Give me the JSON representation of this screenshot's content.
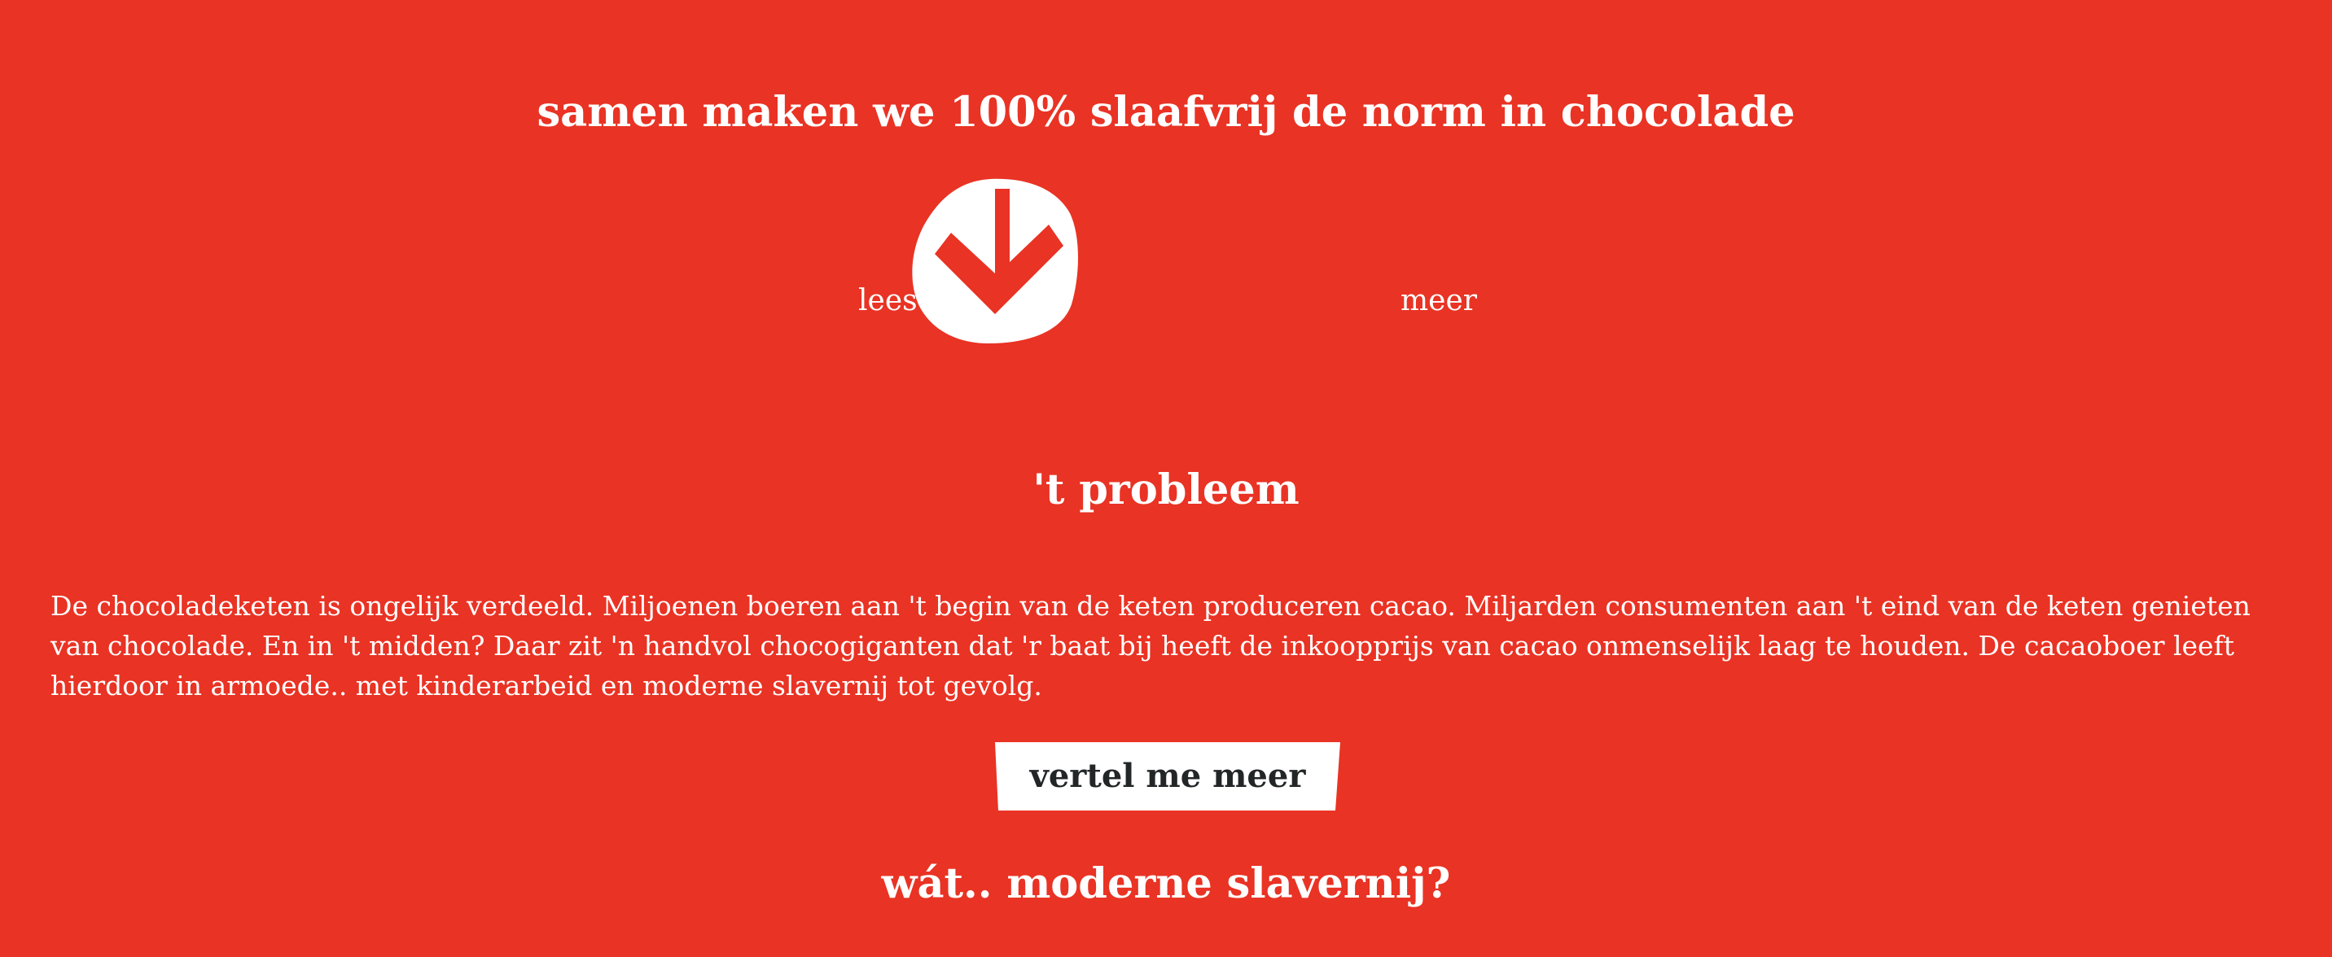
{
  "hero": {
    "title": "samen maken we 100% slaafvrij de norm in chocolade"
  },
  "read_more": {
    "left_word": "lees",
    "right_word": "meer",
    "icon": "down-arrow-blob-icon"
  },
  "problem": {
    "title": "'t probleem",
    "body": "De chocoladeketen is ongelijk verdeeld. Miljoenen boeren aan 't begin van de keten produceren cacao. Miljarden consumenten aan 't eind van de keten genieten van chocolade. En in 't midden? Daar zit 'n handvol chocogiganten dat 'r baat bij heeft de inkoopprijs van cacao onmenselijk laag te houden. De cacaoboer leeft hierdoor in armoede.. met kinderarbeid en moderne slavernij tot gevolg.",
    "cta_label": "vertel me meer"
  },
  "next_section": {
    "title": "wát.. moderne slavernij?"
  },
  "colors": {
    "background": "#E93324",
    "text": "#FFFFFF",
    "button_fill": "#FFFFFF",
    "button_text": "#232627"
  }
}
